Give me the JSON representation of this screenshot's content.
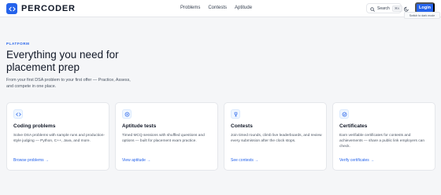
{
  "brand": {
    "name": "PERCODER",
    "accent": "#2563eb"
  },
  "nav": {
    "links": [
      "Problems",
      "Contests",
      "Aptitude"
    ]
  },
  "actions": {
    "search_label": "Search",
    "search_shortcut": "⌘K",
    "login_label": "Login",
    "theme_tooltip": "Switch to dark mode"
  },
  "hero": {
    "eyebrow": "PLATFORM",
    "title": "Everything you need for placement prep",
    "subtitle": "From your first DSA problem to your first offer — Practice, Assess, and compete in one place."
  },
  "cards": [
    {
      "icon": "code-icon",
      "title": "Coding problems",
      "desc": "Solve DSA problems with sample runs and production-style judging — Python, C++, Java, and more.",
      "link": "Browse problems →"
    },
    {
      "icon": "target-icon",
      "title": "Aptitude tests",
      "desc": "Timed MCQ sessions with shuffled questions and options — built for placement exam practice.",
      "link": "View aptitude →"
    },
    {
      "icon": "trophy-icon",
      "title": "Contests",
      "desc": "Join timed rounds, climb live leaderboards, and review every submission after the clock stops.",
      "link": "See contests →"
    },
    {
      "icon": "badge-check-icon",
      "title": "Certificates",
      "desc": "Earn verifiable certificates for contests and achievements — share a public link employers can check.",
      "link": "Verify certificates →"
    }
  ]
}
